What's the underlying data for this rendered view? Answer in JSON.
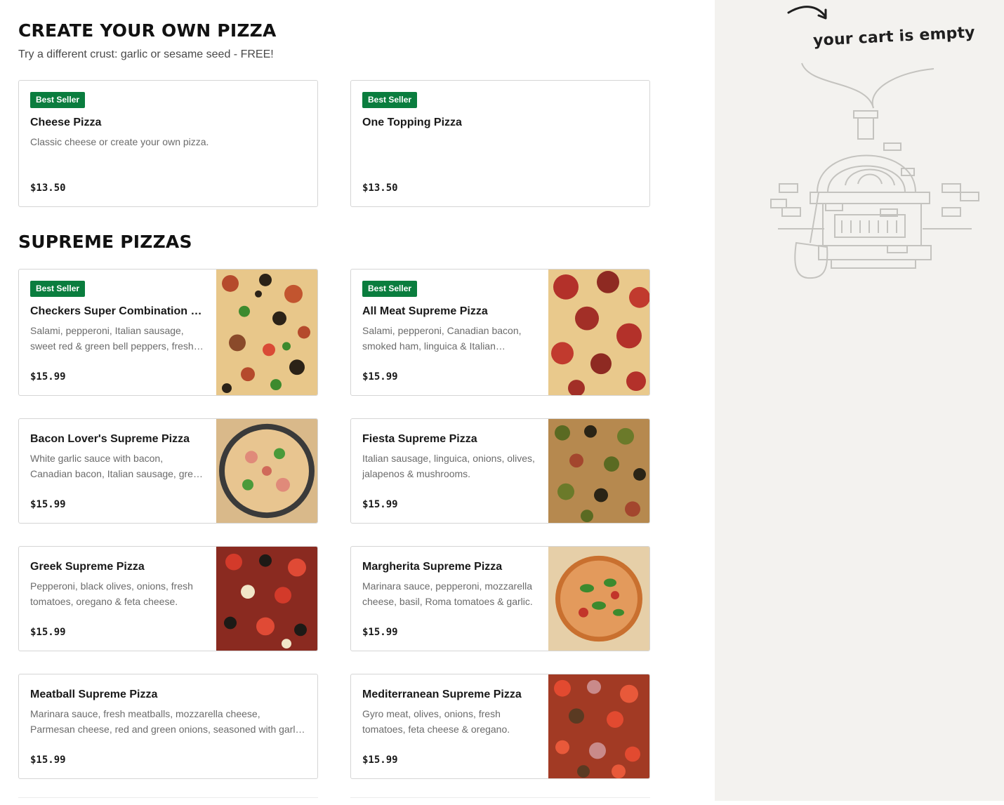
{
  "sections": {
    "create": {
      "title": "CREATE YOUR OWN PIZZA",
      "subtitle": "Try a different crust: garlic or sesame seed - FREE!"
    },
    "supreme": {
      "title": "SUPREME PIZZAS"
    }
  },
  "items": [
    {
      "badge": "Best Seller",
      "name": "Cheese Pizza",
      "desc": "Classic cheese or create your own pizza.",
      "price": "$13.50"
    },
    {
      "badge": "Best Seller",
      "name": "One Topping Pizza",
      "desc": "",
      "price": "$13.50"
    },
    {
      "badge": "Best Seller",
      "name": "Checkers Super Combination Pizza",
      "desc": "Salami, pepperoni, Italian sausage, sweet red & green bell peppers, fresh mushrooms, onions & black olives.",
      "price": "$15.99"
    },
    {
      "badge": "Best Seller",
      "name": "All Meat Supreme Pizza",
      "desc": "Salami, pepperoni, Canadian bacon, smoked ham, linguica & Italian sausage.",
      "price": "$15.99"
    },
    {
      "name": "Bacon Lover's Supreme Pizza",
      "desc": "White garlic sauce with bacon, Canadian bacon, Italian sausage, green onions & tomatoes.",
      "price": "$15.99"
    },
    {
      "name": "Fiesta Supreme Pizza",
      "desc": "Italian sausage, linguica, onions, olives, jalapenos & mushrooms.",
      "price": "$15.99"
    },
    {
      "name": "Greek Supreme Pizza",
      "desc": "Pepperoni, black olives, onions, fresh tomatoes, oregano & feta cheese.",
      "price": "$15.99"
    },
    {
      "name": "Margherita Supreme Pizza",
      "desc": "Marinara sauce, pepperoni, mozzarella cheese, basil, Roma tomatoes & garlic.",
      "price": "$15.99"
    },
    {
      "name": "Meatball Supreme Pizza",
      "desc": "Marinara sauce, fresh meatballs, mozzarella cheese, Parmesan cheese, red and green onions, seasoned with garlic and oregano.",
      "price": "$15.99"
    },
    {
      "name": "Mediterranean Supreme Pizza",
      "desc": "Gyro meat, olives, onions, fresh tomatoes, feta cheese & oregano.",
      "price": "$15.99"
    }
  ],
  "cart": {
    "empty_text": "your cart is empty",
    "illustration": "pizza-oven-icon"
  },
  "colors": {
    "badge": "#0a7d3e",
    "cart_bg": "#f3f2ef",
    "card_border": "#d5d5d5"
  }
}
